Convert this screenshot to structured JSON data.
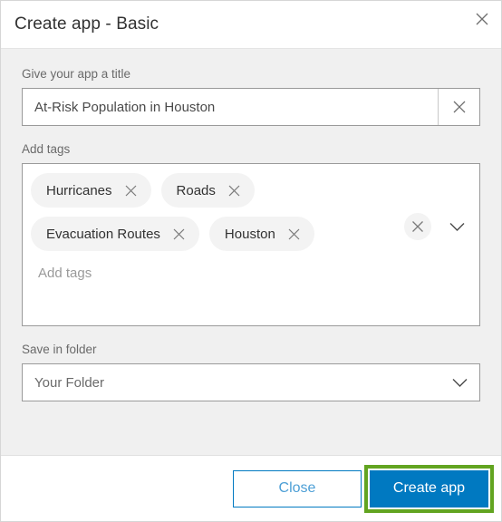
{
  "dialog": {
    "title": "Create app - Basic",
    "close_icon": "close-icon"
  },
  "form": {
    "title_field": {
      "label": "Give your app a title",
      "value": "At-Risk Population in Houston",
      "clear_icon": "close-icon"
    },
    "tags_field": {
      "label": "Add tags",
      "placeholder": "Add tags",
      "value": "",
      "tags": [
        {
          "label": "Hurricanes",
          "remove_icon": "close-icon"
        },
        {
          "label": "Roads",
          "remove_icon": "close-icon"
        },
        {
          "label": "Evacuation Routes",
          "remove_icon": "close-icon"
        },
        {
          "label": "Houston",
          "remove_icon": "close-icon"
        }
      ],
      "clear_all_icon": "close-icon",
      "expand_icon": "chevron-down-icon"
    },
    "folder_field": {
      "label": "Save in folder",
      "value": "Your Folder",
      "chevron_icon": "chevron-down-icon"
    }
  },
  "footer": {
    "close_label": "Close",
    "create_label": "Create app"
  },
  "colors": {
    "accent_blue": "#0079c1",
    "highlight_green": "#62a420",
    "body_background": "#f0f0f0",
    "chip_background": "#f3f3f3"
  }
}
